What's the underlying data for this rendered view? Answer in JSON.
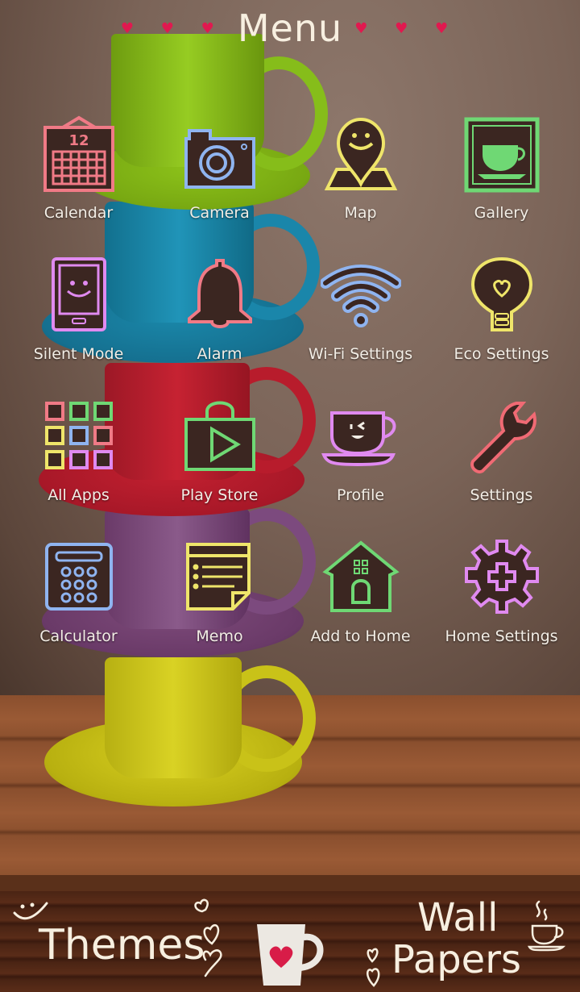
{
  "header": {
    "title": "Menu",
    "hearts_left": "♥ ♥ ♥",
    "hearts_right": "♥ ♥ ♥"
  },
  "colors": {
    "heart": "#e0194f",
    "label": "#f3eee6",
    "icon_fill": "#3b2621",
    "pink": "#f07a86",
    "blue": "#8fb4f0",
    "yellow": "#efe56a",
    "green": "#6fd874",
    "violet": "#e08af0",
    "red": "#f06a74"
  },
  "menu": {
    "items": [
      {
        "label": "Calendar",
        "icon": "calendar-icon",
        "calendar_day": "12"
      },
      {
        "label": "Camera",
        "icon": "camera-icon"
      },
      {
        "label": "Map",
        "icon": "map-pin-icon"
      },
      {
        "label": "Gallery",
        "icon": "gallery-cup-icon"
      },
      {
        "label": "Silent Mode",
        "icon": "phone-icon"
      },
      {
        "label": "Alarm",
        "icon": "bell-icon"
      },
      {
        "label": "Wi-Fi Settings",
        "icon": "wifi-icon"
      },
      {
        "label": "Eco Settings",
        "icon": "lightbulb-icon"
      },
      {
        "label": "All Apps",
        "icon": "app-grid-icon"
      },
      {
        "label": "Play Store",
        "icon": "shopping-bag-play-icon"
      },
      {
        "label": "Profile",
        "icon": "teacup-face-icon"
      },
      {
        "label": "Settings",
        "icon": "wrench-icon"
      },
      {
        "label": "Calculator",
        "icon": "calculator-icon"
      },
      {
        "label": "Memo",
        "icon": "memo-icon"
      },
      {
        "label": "Add to Home",
        "icon": "house-icon"
      },
      {
        "label": "Home Settings",
        "icon": "gear-plus-icon"
      }
    ]
  },
  "bottom": {
    "themes_label": "Themes",
    "wallpapers_line1": "Wall",
    "wallpapers_line2": "Papers"
  }
}
